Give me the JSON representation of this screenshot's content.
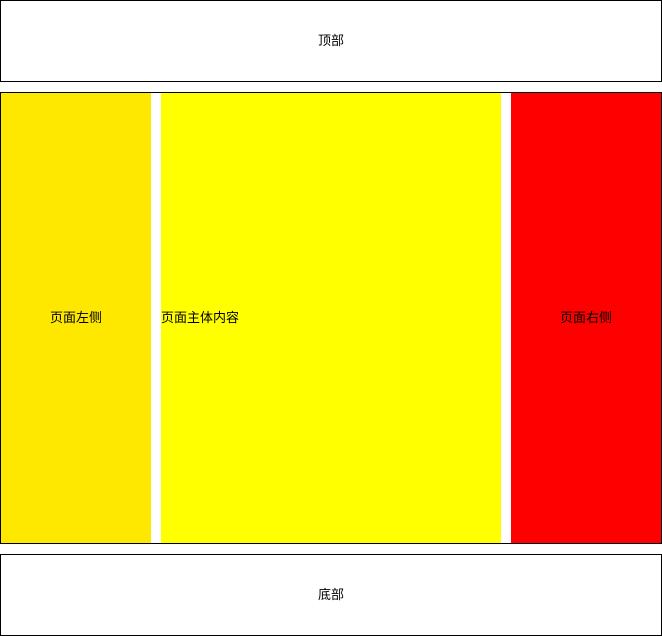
{
  "header": {
    "label": "顶部"
  },
  "main": {
    "left": {
      "label": "页面左侧",
      "color": "#FFE800"
    },
    "center": {
      "label": "页面主体内容",
      "color": "#FFFF00"
    },
    "right": {
      "label": "页面右侧",
      "color": "#FF0000"
    }
  },
  "footer": {
    "label": "底部"
  }
}
